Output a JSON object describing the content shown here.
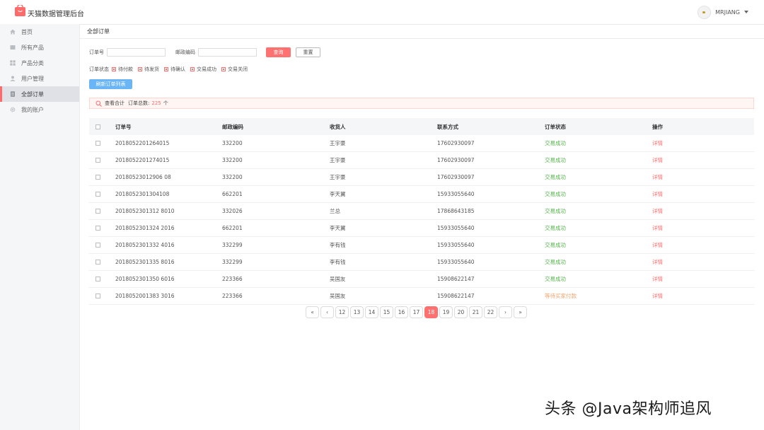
{
  "header": {
    "app_title": "天猫数据管理后台",
    "username": "MRJIANG",
    "brand_color": "#ff6a6a"
  },
  "sidebar": {
    "items": [
      {
        "label": "首页",
        "icon": "home-icon"
      },
      {
        "label": "所有产品",
        "icon": "product-icon"
      },
      {
        "label": "产品分类",
        "icon": "grid-icon"
      },
      {
        "label": "用户管理",
        "icon": "user-icon"
      },
      {
        "label": "全部订单",
        "icon": "order-icon",
        "active": true
      },
      {
        "label": "我的账户",
        "icon": "gear-icon"
      }
    ]
  },
  "main": {
    "breadcrumb": "全部订单",
    "filter": {
      "order_no_label": "订单号",
      "order_no_value": "",
      "postcode_label": "邮政编码",
      "postcode_value": "",
      "search_label": "查询",
      "reset_label": "重置"
    },
    "status_filter": {
      "label": "订单状态",
      "options": [
        "待付款",
        "待发货",
        "待确认",
        "交易成功",
        "交易关闭"
      ]
    },
    "refresh_label": "刷新订单列表",
    "summary": {
      "prefix": "查看合计",
      "total_label": "订单总数:",
      "count": "225",
      "unit": "个"
    },
    "table": {
      "columns": [
        "订单号",
        "邮政编码",
        "收货人",
        "联系方式",
        "订单状态",
        "操作"
      ],
      "rows": [
        {
          "order_no": "2018052201264015",
          "postcode": "332200",
          "receiver": "王宇豪",
          "phone": "17602930097",
          "status": "交易成功",
          "action": "详情"
        },
        {
          "order_no": "2018052201274015",
          "postcode": "332200",
          "receiver": "王宇豪",
          "phone": "17602930097",
          "status": "交易成功",
          "action": "详情"
        },
        {
          "order_no": "20180523012906 08",
          "postcode": "332200",
          "receiver": "王宇豪",
          "phone": "17602930097",
          "status": "交易成功",
          "action": "详情"
        },
        {
          "order_no": "2018052301304108",
          "postcode": "662201",
          "receiver": "李天翼",
          "phone": "15933055640",
          "status": "交易成功",
          "action": "详情"
        },
        {
          "order_no": "2018052301312 8010",
          "postcode": "332026",
          "receiver": "兰总",
          "phone": "17868643185",
          "status": "交易成功",
          "action": "详情"
        },
        {
          "order_no": "2018052301324 2016",
          "postcode": "662201",
          "receiver": "李天翼",
          "phone": "15933055640",
          "status": "交易成功",
          "action": "详情"
        },
        {
          "order_no": "2018052301332 4016",
          "postcode": "332299",
          "receiver": "李有钱",
          "phone": "15933055640",
          "status": "交易成功",
          "action": "详情"
        },
        {
          "order_no": "2018052301335 8016",
          "postcode": "332299",
          "receiver": "李有钱",
          "phone": "15933055640",
          "status": "交易成功",
          "action": "详情"
        },
        {
          "order_no": "2018052301350 6016",
          "postcode": "223366",
          "receiver": "吴国友",
          "phone": "15908622147",
          "status": "交易成功",
          "action": "详情"
        },
        {
          "order_no": "2018052001383 3016",
          "postcode": "223366",
          "receiver": "吴国友",
          "phone": "15908622147",
          "status": "等待买家付款",
          "action": "详情"
        }
      ]
    },
    "pagination": {
      "first": "«",
      "prev": "‹",
      "pages": [
        "12",
        "13",
        "14",
        "15",
        "16",
        "17",
        "18",
        "19",
        "20",
        "21",
        "22"
      ],
      "current": "18",
      "next": "›",
      "last": "»"
    }
  },
  "watermark": "头条 @Java架构师追风"
}
